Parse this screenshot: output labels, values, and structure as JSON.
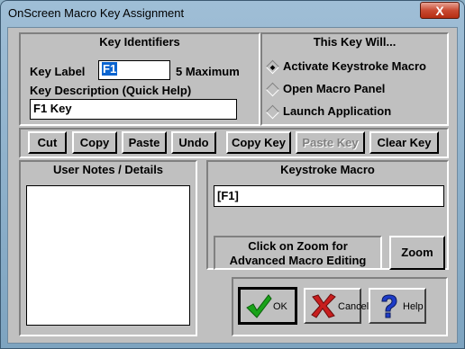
{
  "window": {
    "title": "OnScreen Macro Key Assignment",
    "close_glyph": "X"
  },
  "key_identifiers": {
    "header": "Key Identifiers",
    "key_label_label": "Key Label",
    "key_label_value": "F1",
    "max_label": "5 Maximum",
    "description_label": "Key Description (Quick Help)",
    "description_value": "F1 Key"
  },
  "this_key_will": {
    "header": "This Key Will...",
    "options": [
      {
        "label": "Activate Keystroke Macro",
        "selected": true
      },
      {
        "label": "Open Macro Panel",
        "selected": false
      },
      {
        "label": "Launch Application",
        "selected": false
      }
    ]
  },
  "edit_buttons": {
    "cut": "Cut",
    "copy": "Copy",
    "paste": "Paste",
    "undo": "Undo"
  },
  "key_buttons": {
    "copy_key": "Copy Key",
    "paste_key": "Paste Key",
    "clear_key": "Clear Key"
  },
  "user_notes": {
    "header": "User Notes / Details",
    "value": ""
  },
  "keystroke_macro": {
    "header": "Keystroke Macro",
    "value": "[F1]",
    "zoom_hint_line1": "Click on Zoom for",
    "zoom_hint_line2": "Advanced Macro Editing",
    "zoom_button": "Zoom"
  },
  "dialog_buttons": {
    "ok": "OK",
    "cancel": "Cancel",
    "help": "Help"
  },
  "colors": {
    "dialog_bg": "#c0c0c0",
    "highlight": "#0a64d0",
    "ok_check": "#1aa31a",
    "cancel_x": "#c81e1e",
    "help_blue": "#1e3cc8"
  }
}
